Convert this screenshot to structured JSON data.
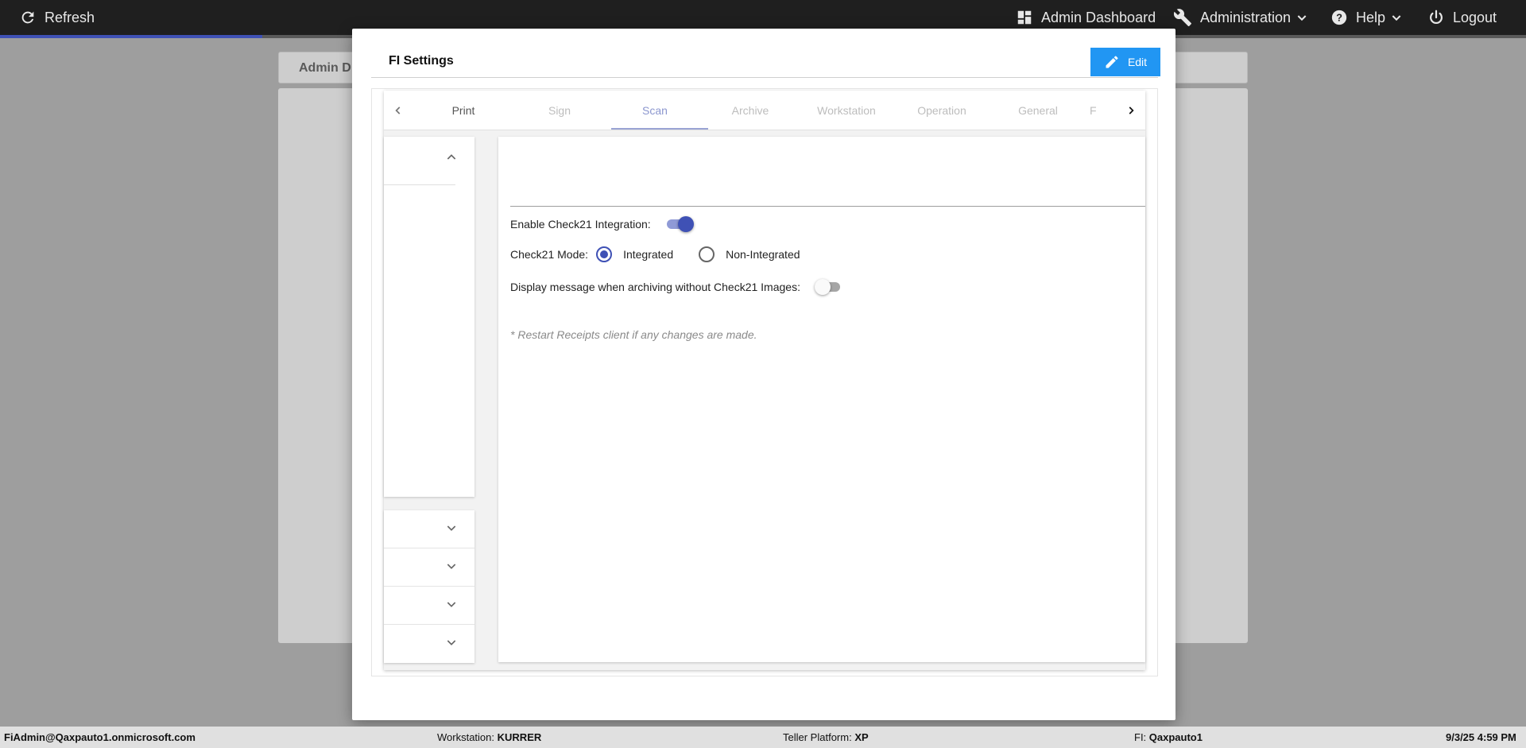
{
  "topbar": {
    "refresh_label": "Refresh",
    "admin_dashboard_label": "Admin Dashboard",
    "administration_label": "Administration",
    "help_label": "Help",
    "logout_label": "Logout"
  },
  "background": {
    "tab_label": "Admin D"
  },
  "modal": {
    "title": "FI Settings",
    "edit_label": "Edit",
    "tabs": [
      {
        "label": "Print"
      },
      {
        "label": "Sign"
      },
      {
        "label": "Scan"
      },
      {
        "label": "Archive"
      },
      {
        "label": "Workstation"
      },
      {
        "label": "Operation"
      },
      {
        "label": "General"
      },
      {
        "label": "F"
      }
    ],
    "selected_tab": "Scan",
    "content": {
      "enable_check21_label": "Enable Check21 Integration:",
      "enable_check21_on": true,
      "check21_mode_label": "Check21 Mode:",
      "mode_options": [
        "Integrated",
        "Non-Integrated"
      ],
      "mode_selected": "Integrated",
      "display_message_label": "Display message when archiving without Check21 Images:",
      "display_message_on": false,
      "restart_note": "* Restart Receipts client if any changes are made."
    }
  },
  "footer": {
    "user": "FiAdmin@Qaxpauto1.onmicrosoft.com",
    "workstation_label": "Workstation:",
    "workstation_value": "KURRER",
    "platform_label": "Teller Platform:",
    "platform_value": "XP",
    "fi_label": "FI:",
    "fi_value": "Qaxpauto1",
    "datetime": "9/3/25 4:59 PM"
  },
  "colors": {
    "accent": "#3f51b5",
    "edit_button": "#2196f3",
    "topbar": "#1f1f1f"
  }
}
